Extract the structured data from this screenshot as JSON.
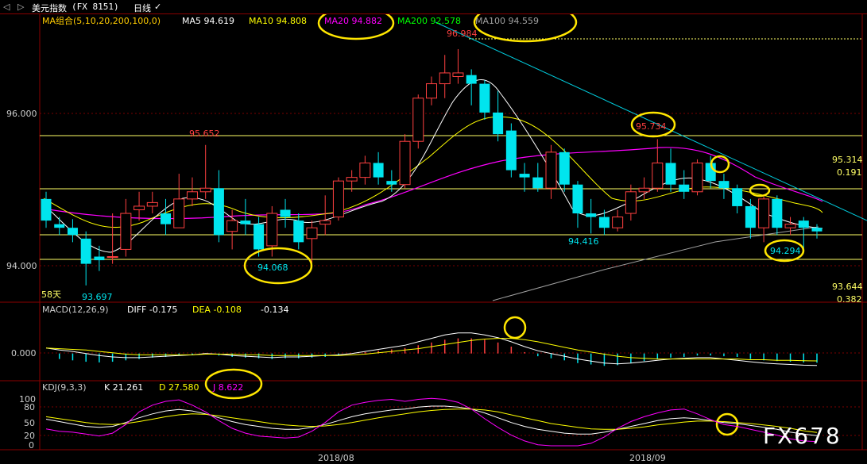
{
  "window": {
    "back_label": "◁",
    "forward_label": "▷",
    "instrument": "美元指数",
    "code": "(FX 8151)",
    "period": "日线",
    "period_arrow": "✓"
  },
  "main_panel": {
    "indicator_label": "MA组合(5,10,20,200,100,0)",
    "ma5": "MA5 94.619",
    "ma10": "MA10 94.808",
    "ma20": "MA20 94.882",
    "ma200": "MA200 92.578",
    "ma100": "MA100 94.559",
    "y_ticks": [
      "96.000",
      "94.000"
    ],
    "annotations": {
      "high_peak": "96.984",
      "left_peak": "95.652",
      "left_low": "93.697",
      "circled_low": "94.068",
      "mid_low": "94.416",
      "circled_high": "95.734",
      "circled_recent": "94.294",
      "level_upper": "95.314",
      "level_upper_ratio": "0.191",
      "level_lower": "93.644",
      "level_lower_ratio": "0.382",
      "days": "58天"
    }
  },
  "macd_panel": {
    "label": "MACD(12,26,9)",
    "diff": "DIFF -0.175",
    "dea": "DEA -0.108",
    "macd": "-0.134",
    "y_ticks": [
      "0.000"
    ]
  },
  "kdj_panel": {
    "label": "KDJ(9,3,3)",
    "k": "K 21.261",
    "d": "D 27.580",
    "j": "J 8.622",
    "y_ticks": [
      "100",
      "80",
      "50",
      "20",
      "0"
    ]
  },
  "x_axis": {
    "labels": [
      "2018/08",
      "2018/09"
    ]
  },
  "watermark": "FX678",
  "colors": {
    "up": "#ff4040",
    "down": "#00e5ee",
    "ma5": "#ffffff",
    "ma10": "#ffff00",
    "ma20": "#ff00ff",
    "ma200": "#00ff00",
    "ma100": "#a0a0a0",
    "trend": "#00ccdd",
    "circle": "#ffe600",
    "level": "#ffff66"
  },
  "chart_data": {
    "type": "candlestick",
    "y_range": [
      93.5,
      97.2
    ],
    "candles": [
      {
        "o": 94.9,
        "h": 95.0,
        "c": 94.6,
        "l": 94.5
      },
      {
        "o": 94.55,
        "h": 94.65,
        "c": 94.5,
        "l": 94.4
      },
      {
        "o": 94.5,
        "h": 94.62,
        "c": 94.4,
        "l": 94.3
      },
      {
        "o": 94.35,
        "h": 94.45,
        "c": 94.0,
        "l": 93.7
      },
      {
        "o": 94.1,
        "h": 94.25,
        "c": 94.05,
        "l": 93.9
      },
      {
        "o": 94.1,
        "h": 94.7,
        "c": 94.1,
        "l": 94.0
      },
      {
        "o": 94.2,
        "h": 94.9,
        "c": 94.7,
        "l": 94.1
      },
      {
        "o": 94.75,
        "h": 95.0,
        "c": 94.8,
        "l": 94.6
      },
      {
        "o": 94.8,
        "h": 95.0,
        "c": 94.85,
        "l": 94.7
      },
      {
        "o": 94.7,
        "h": 94.9,
        "c": 94.55,
        "l": 94.4
      },
      {
        "o": 94.5,
        "h": 95.25,
        "c": 94.9,
        "l": 94.5
      },
      {
        "o": 94.9,
        "h": 95.2,
        "c": 95.0,
        "l": 94.8
      },
      {
        "o": 95.0,
        "h": 95.65,
        "c": 95.05,
        "l": 94.9
      },
      {
        "o": 95.05,
        "h": 95.3,
        "c": 94.4,
        "l": 94.3
      },
      {
        "o": 94.45,
        "h": 94.75,
        "c": 94.6,
        "l": 94.2
      },
      {
        "o": 94.6,
        "h": 94.9,
        "c": 94.55,
        "l": 94.4
      },
      {
        "o": 94.55,
        "h": 94.65,
        "c": 94.2,
        "l": 94.1
      },
      {
        "o": 94.25,
        "h": 94.8,
        "c": 94.7,
        "l": 94.1
      },
      {
        "o": 94.75,
        "h": 94.9,
        "c": 94.65,
        "l": 94.5
      },
      {
        "o": 94.6,
        "h": 94.7,
        "c": 94.3,
        "l": 94.2
      },
      {
        "o": 94.35,
        "h": 94.6,
        "c": 94.5,
        "l": 94.0
      },
      {
        "o": 94.55,
        "h": 94.95,
        "c": 94.6,
        "l": 94.4
      },
      {
        "o": 94.65,
        "h": 95.2,
        "c": 95.15,
        "l": 94.6
      },
      {
        "o": 95.15,
        "h": 95.3,
        "c": 95.2,
        "l": 95.0
      },
      {
        "o": 95.2,
        "h": 95.5,
        "c": 95.4,
        "l": 95.1
      },
      {
        "o": 95.4,
        "h": 95.55,
        "c": 95.2,
        "l": 95.1
      },
      {
        "o": 95.15,
        "h": 95.3,
        "c": 95.1,
        "l": 95.0
      },
      {
        "o": 95.1,
        "h": 95.8,
        "c": 95.7,
        "l": 95.05
      },
      {
        "o": 95.7,
        "h": 96.35,
        "c": 96.3,
        "l": 95.6
      },
      {
        "o": 96.3,
        "h": 96.6,
        "c": 96.5,
        "l": 96.2
      },
      {
        "o": 96.5,
        "h": 96.9,
        "c": 96.65,
        "l": 96.3
      },
      {
        "o": 96.6,
        "h": 96.98,
        "c": 96.65,
        "l": 96.5
      },
      {
        "o": 96.62,
        "h": 96.7,
        "c": 96.5,
        "l": 96.2
      },
      {
        "o": 96.5,
        "h": 96.55,
        "c": 96.1,
        "l": 96.0
      },
      {
        "o": 96.1,
        "h": 96.4,
        "c": 95.8,
        "l": 95.7
      },
      {
        "o": 95.85,
        "h": 95.95,
        "c": 95.3,
        "l": 95.2
      },
      {
        "o": 95.25,
        "h": 95.4,
        "c": 95.2,
        "l": 95.0
      },
      {
        "o": 95.2,
        "h": 95.4,
        "c": 95.05,
        "l": 95.0
      },
      {
        "o": 95.05,
        "h": 95.65,
        "c": 95.55,
        "l": 94.9
      },
      {
        "o": 95.55,
        "h": 95.6,
        "c": 95.1,
        "l": 95.0
      },
      {
        "o": 95.1,
        "h": 95.15,
        "c": 94.7,
        "l": 94.5
      },
      {
        "o": 94.7,
        "h": 94.9,
        "c": 94.65,
        "l": 94.42
      },
      {
        "o": 94.65,
        "h": 94.75,
        "c": 94.5,
        "l": 94.4
      },
      {
        "o": 94.5,
        "h": 94.75,
        "c": 94.65,
        "l": 94.45
      },
      {
        "o": 94.7,
        "h": 95.1,
        "c": 95.0,
        "l": 94.6
      },
      {
        "o": 95.0,
        "h": 95.2,
        "c": 95.05,
        "l": 94.9
      },
      {
        "o": 95.05,
        "h": 95.73,
        "c": 95.4,
        "l": 95.0
      },
      {
        "o": 95.4,
        "h": 95.6,
        "c": 95.1,
        "l": 95.0
      },
      {
        "o": 95.1,
        "h": 95.3,
        "c": 95.0,
        "l": 94.9
      },
      {
        "o": 95.0,
        "h": 95.45,
        "c": 95.4,
        "l": 94.95
      },
      {
        "o": 95.4,
        "h": 95.5,
        "c": 95.15,
        "l": 95.05
      },
      {
        "o": 95.15,
        "h": 95.25,
        "c": 95.05,
        "l": 94.9
      },
      {
        "o": 95.05,
        "h": 95.1,
        "c": 94.8,
        "l": 94.7
      },
      {
        "o": 94.8,
        "h": 94.9,
        "c": 94.5,
        "l": 94.35
      },
      {
        "o": 94.5,
        "h": 94.95,
        "c": 94.9,
        "l": 94.3
      },
      {
        "o": 94.9,
        "h": 94.95,
        "c": 94.5,
        "l": 94.4
      },
      {
        "o": 94.5,
        "h": 94.65,
        "c": 94.55,
        "l": 94.4
      },
      {
        "o": 94.6,
        "h": 94.65,
        "c": 94.5,
        "l": 94.2
      },
      {
        "o": 94.5,
        "h": 94.55,
        "c": 94.45,
        "l": 94.35
      }
    ],
    "horizontal_levels": [
      95.314,
      93.644
    ],
    "macd": {
      "y_range": [
        -0.35,
        0.55
      ],
      "bars": [
        0.0,
        -0.08,
        -0.1,
        -0.12,
        -0.13,
        -0.12,
        -0.1,
        -0.08,
        -0.06,
        -0.05,
        -0.03,
        -0.02,
        0.0,
        -0.03,
        -0.05,
        -0.06,
        -0.07,
        -0.08,
        -0.07,
        -0.07,
        -0.06,
        -0.05,
        -0.03,
        0.0,
        0.02,
        0.04,
        0.06,
        0.08,
        0.12,
        0.16,
        0.2,
        0.22,
        0.22,
        0.2,
        0.16,
        0.1,
        0.02,
        -0.04,
        -0.07,
        -0.1,
        -0.14,
        -0.16,
        -0.18,
        -0.17,
        -0.14,
        -0.11,
        -0.08,
        -0.06,
        -0.05,
        -0.03,
        -0.03,
        -0.04,
        -0.05,
        -0.08,
        -0.1,
        -0.11,
        -0.12,
        -0.13,
        -0.134
      ],
      "diff": [
        0.08,
        0.05,
        0.03,
        0.0,
        -0.03,
        -0.05,
        -0.06,
        -0.06,
        -0.05,
        -0.04,
        -0.03,
        -0.02,
        0.0,
        -0.01,
        -0.03,
        -0.04,
        -0.05,
        -0.06,
        -0.05,
        -0.05,
        -0.04,
        -0.03,
        -0.02,
        0.0,
        0.03,
        0.06,
        0.09,
        0.12,
        0.17,
        0.22,
        0.27,
        0.3,
        0.3,
        0.27,
        0.23,
        0.17,
        0.1,
        0.04,
        0.0,
        -0.04,
        -0.08,
        -0.11,
        -0.14,
        -0.15,
        -0.14,
        -0.12,
        -0.1,
        -0.08,
        -0.07,
        -0.06,
        -0.06,
        -0.08,
        -0.1,
        -0.12,
        -0.14,
        -0.15,
        -0.16,
        -0.17,
        -0.175
      ],
      "dea": [
        0.08,
        0.07,
        0.06,
        0.05,
        0.03,
        0.01,
        -0.01,
        -0.02,
        -0.02,
        -0.02,
        -0.02,
        -0.02,
        -0.01,
        -0.01,
        -0.01,
        -0.02,
        -0.02,
        -0.03,
        -0.03,
        -0.03,
        -0.03,
        -0.03,
        -0.03,
        -0.02,
        -0.01,
        0.01,
        0.03,
        0.05,
        0.07,
        0.1,
        0.13,
        0.16,
        0.19,
        0.21,
        0.22,
        0.22,
        0.2,
        0.17,
        0.13,
        0.09,
        0.05,
        0.02,
        -0.01,
        -0.04,
        -0.06,
        -0.07,
        -0.08,
        -0.08,
        -0.08,
        -0.08,
        -0.08,
        -0.08,
        -0.08,
        -0.09,
        -0.09,
        -0.1,
        -0.1,
        -0.105,
        -0.108
      ]
    },
    "kdj": {
      "y_range": [
        -5,
        110
      ],
      "k": [
        55,
        50,
        45,
        40,
        38,
        40,
        48,
        58,
        66,
        72,
        75,
        72,
        66,
        58,
        50,
        44,
        40,
        36,
        34,
        34,
        38,
        44,
        52,
        60,
        66,
        70,
        74,
        76,
        80,
        82,
        82,
        80,
        76,
        68,
        58,
        48,
        40,
        34,
        30,
        26,
        24,
        24,
        28,
        34,
        40,
        46,
        52,
        56,
        58,
        56,
        52,
        48,
        46,
        42,
        38,
        34,
        28,
        24,
        21
      ],
      "d": [
        60,
        56,
        52,
        48,
        45,
        44,
        46,
        50,
        55,
        60,
        64,
        66,
        65,
        62,
        58,
        54,
        50,
        46,
        43,
        41,
        40,
        41,
        44,
        48,
        53,
        58,
        62,
        66,
        70,
        73,
        75,
        76,
        76,
        74,
        70,
        64,
        58,
        52,
        46,
        42,
        38,
        35,
        34,
        34,
        36,
        39,
        43,
        46,
        49,
        51,
        51,
        50,
        48,
        46,
        43,
        40,
        36,
        31,
        27.58
      ],
      "j": [
        35,
        30,
        28,
        24,
        20,
        26,
        44,
        70,
        84,
        92,
        95,
        84,
        70,
        52,
        36,
        26,
        20,
        18,
        16,
        18,
        30,
        48,
        70,
        84,
        90,
        94,
        96,
        92,
        96,
        98,
        96,
        90,
        76,
        56,
        38,
        22,
        10,
        2,
        0,
        0,
        0,
        5,
        18,
        36,
        50,
        60,
        68,
        74,
        76,
        66,
        54,
        44,
        40,
        34,
        28,
        22,
        14,
        10,
        8.622
      ]
    }
  }
}
